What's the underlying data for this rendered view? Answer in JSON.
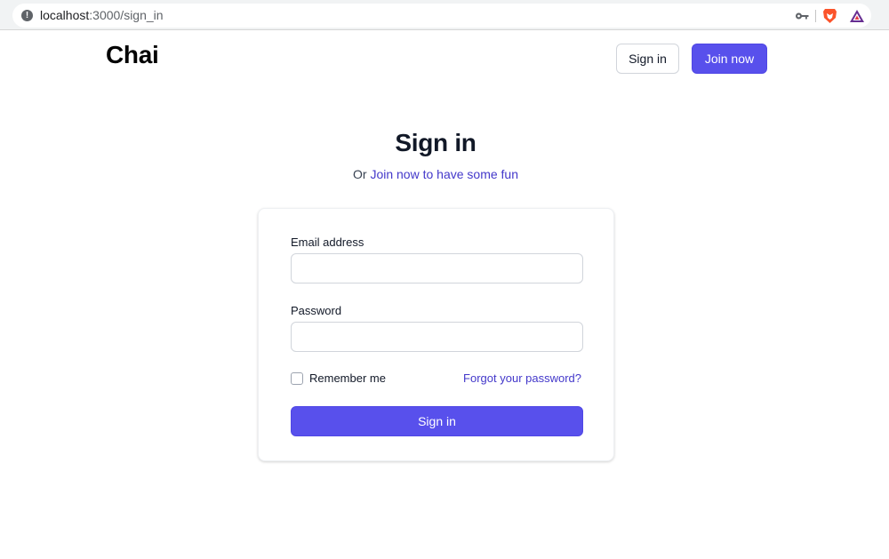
{
  "browser": {
    "url_host": "localhost",
    "url_path": ":3000/sign_in",
    "icons": [
      "info-icon",
      "key-icon",
      "brave-lion-icon",
      "extension-triangle-icon"
    ]
  },
  "header": {
    "logo": "Chai",
    "signin_label": "Sign in",
    "join_label": "Join now"
  },
  "page": {
    "title": "Sign in",
    "subtitle_prefix": "Or ",
    "subtitle_link": "Join now to have some fun"
  },
  "form": {
    "email_label": "Email address",
    "email_value": "",
    "password_label": "Password",
    "password_value": "",
    "remember_label": "Remember me",
    "remember_checked": false,
    "forgot_label": "Forgot your password?",
    "submit_label": "Sign in"
  },
  "colors": {
    "primary": "#5850ec",
    "link": "#4338ca",
    "text": "#111827"
  }
}
